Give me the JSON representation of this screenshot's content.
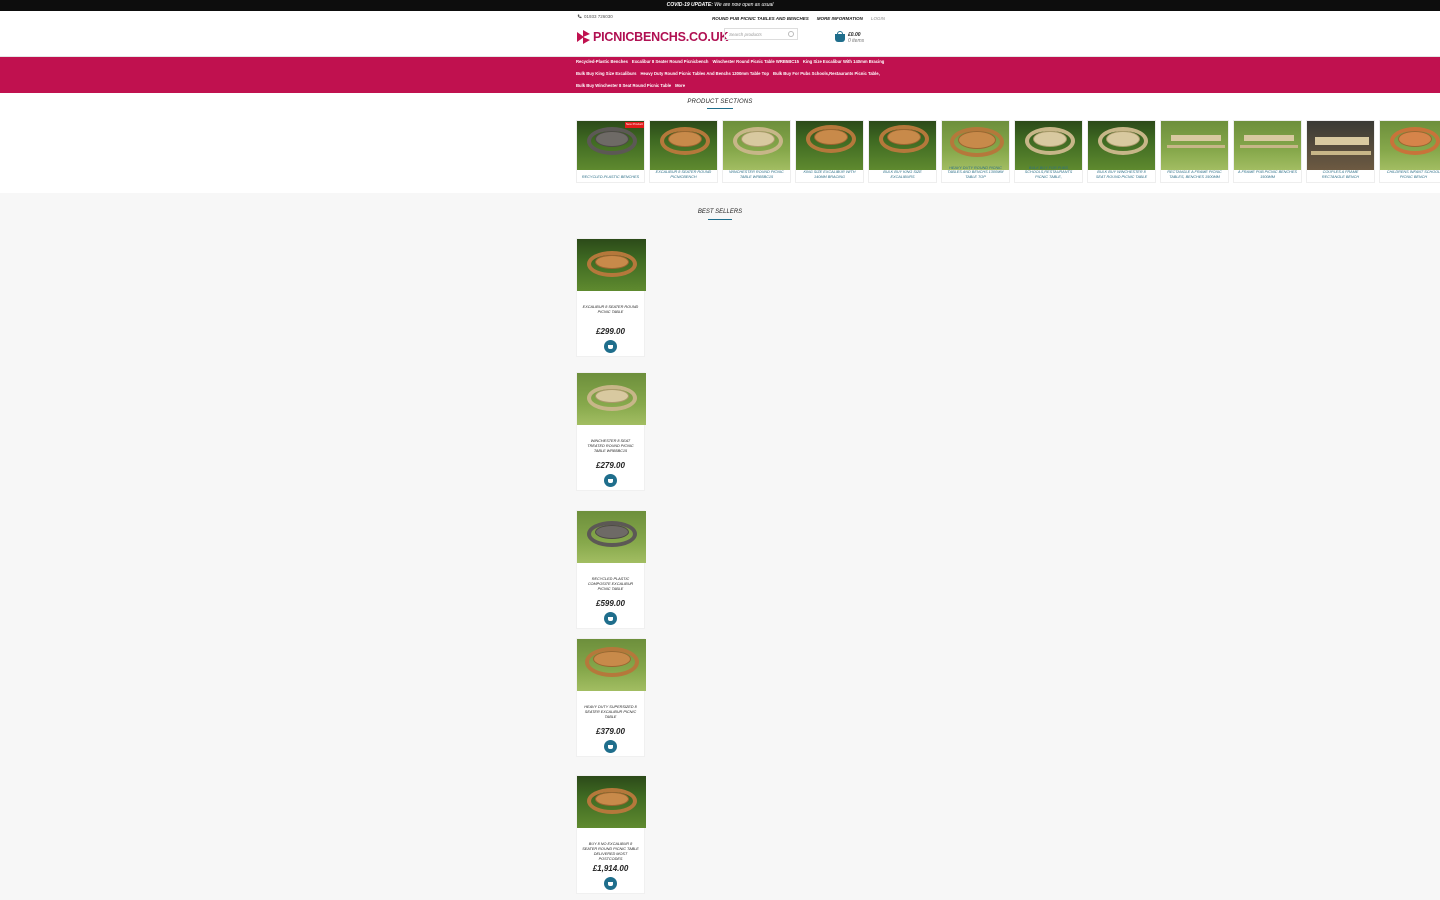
{
  "announcement": {
    "strong": "COVID-19 UPDATE:",
    "text": " We are now open as usual"
  },
  "header": {
    "phone": "01933 726030",
    "links": [
      "ROUND PUB PICNIC TABLES AND BENCHES",
      "MORE INFORMATION",
      "LOGIN"
    ],
    "logo_text": "PICNICBENCHS.CO.UK",
    "search_placeholder": "Search products",
    "cart_amount": "£0.00",
    "cart_count": "0 items"
  },
  "colors": {
    "brand": "#c0114f",
    "accent": "#1f6e8c"
  },
  "nav": {
    "row1": [
      "Recycled-Plastic Benches",
      "Excalibur 8 Seater Round Picnicbench",
      "Winchester Round Picnic Table WRB5BC15",
      "King Size Excalibur With 140mm Bracing"
    ],
    "row2": [
      "Bulk Buy King Size Excaliburs",
      "Heavy Duty Round Picnic Tables And Benchs 1300mm Table Top",
      "Bulk Buy For Pubs Schools,Restaurants Picnic Table,"
    ],
    "row3": [
      "Bulk Buy Winchester 8 Seat Round Picnic Table",
      "More"
    ]
  },
  "sections": {
    "title": "PRODUCT SECTIONS",
    "badge": "New Product",
    "items": [
      "RECYCLED-PLASTIC BENCHES",
      "EXCALIBUR 8 SEATER ROUND PICNICBENCH",
      "WINCHESTER ROUND PICNIC TABLE WRB5BC15",
      "KING SIZE EXCALIBUR WITH 140MM BRACING",
      "BULK BUY KING SIZE EXCALIBURS",
      "HEAVY DUTY ROUND PICNIC TABLES AND BENCHS 1300MM TABLE TOP",
      "BULK BUY FOR PUBS SCHOOLS,RESTAURANTS PICNIC TABLE,",
      "BULK BUY WINCHESTER 8 SEAT ROUND PICNIC TABLE",
      "RECTANGLE A FRAME PICNIC TABLES, BENCHES 1500MM",
      "A FRAME PUB PICNIC BENCHES 1500MM",
      "COUPLES A FRAME RECTANGLE BENCH",
      "CHILDRENS INFANT SCHOOL PICNIC BENCH"
    ]
  },
  "best_sellers": {
    "title": "BEST SELLERS",
    "products": [
      {
        "name": "EXCALIBUR 8 SEATER ROUND PICNIC TABLE",
        "price": "£299.00"
      },
      {
        "name": "WINCHESTER 8 SEAT TREATED ROUND PICNIC TABLE WRB5BC15",
        "price": "£279.00"
      },
      {
        "name": "RECYCLED PLASTIC COMPOSITE EXCALIBUR PICNIC TABLE",
        "price": "£599.00"
      },
      {
        "name": "HEAVY DUTY SUPERSIZED 8 SEATER EXCALIBUR PICNIC TABLE",
        "price": "£379.00"
      },
      {
        "name": "BUY 8 NO EXCALIBUR 8 SEATER ROUND PICNIC TABLE DELIVERED MOST POSTCODES",
        "price": "£1,914.00"
      }
    ]
  }
}
